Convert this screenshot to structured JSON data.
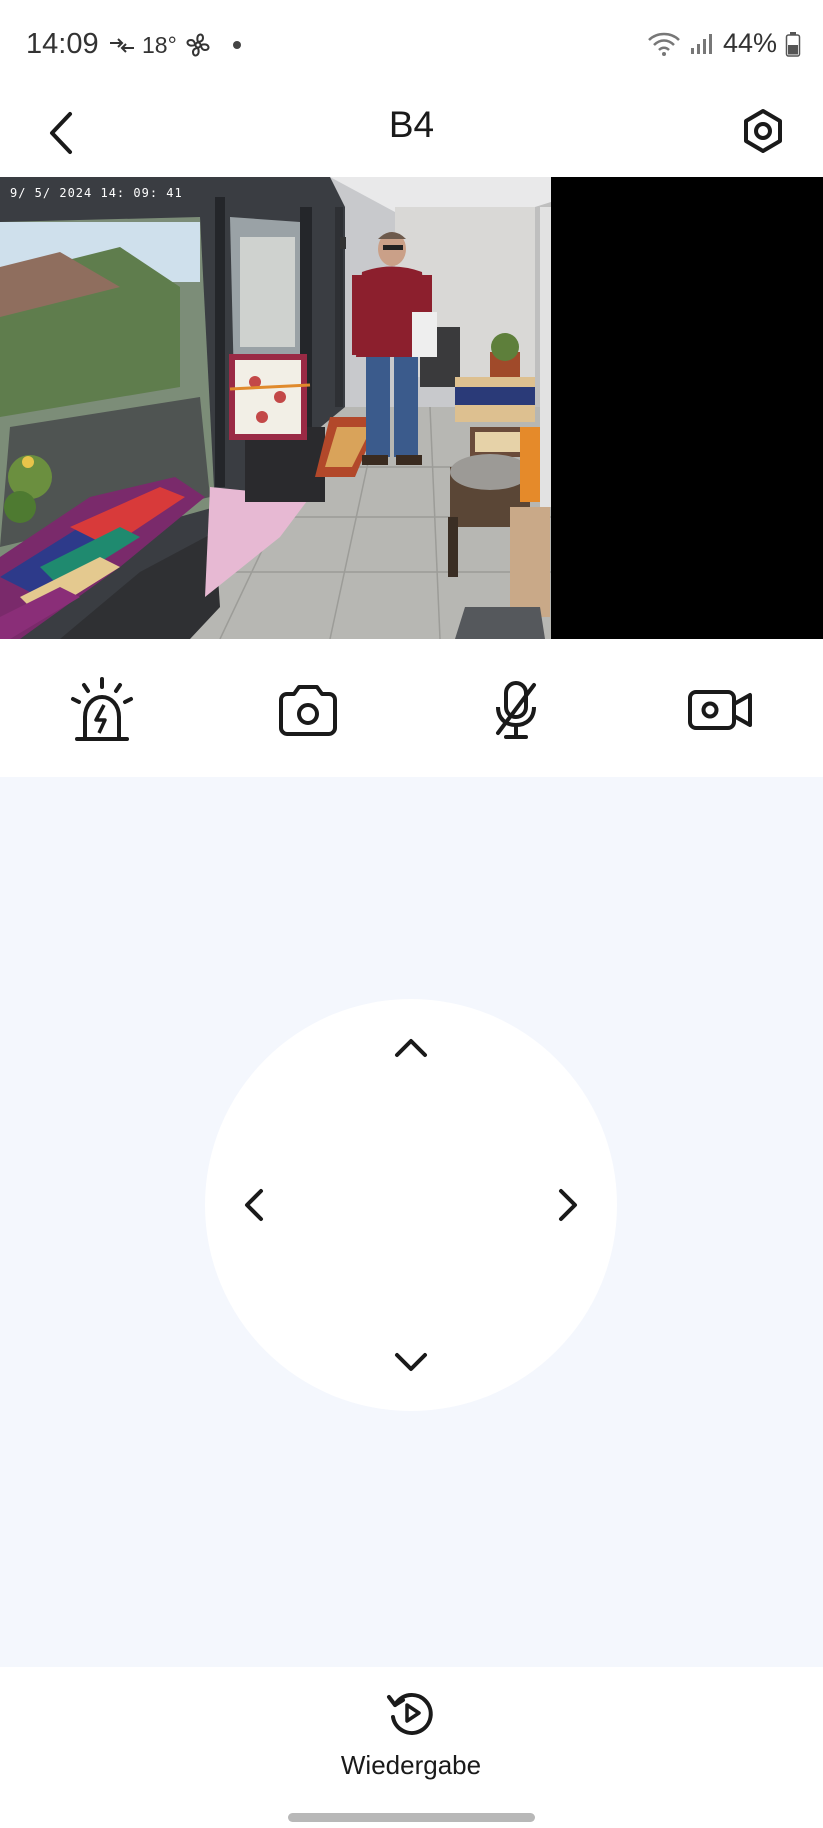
{
  "status_bar": {
    "time": "14:09",
    "temperature": "18°",
    "battery": "44%",
    "icons": [
      "data-transfer-icon",
      "fan-icon",
      "notification-dot",
      "wifi-icon",
      "signal-icon",
      "battery-icon"
    ]
  },
  "header": {
    "title": "B4",
    "back_icon": "chevron-left-icon",
    "settings_icon": "hexagon-settings-icon"
  },
  "video": {
    "timestamp": "9/ 5/ 2024  14: 09: 41"
  },
  "controls": [
    {
      "name": "siren-button",
      "icon": "siren-icon"
    },
    {
      "name": "snapshot-button",
      "icon": "camera-icon"
    },
    {
      "name": "microphone-button",
      "icon": "microphone-muted-icon"
    },
    {
      "name": "record-button",
      "icon": "video-camera-icon"
    }
  ],
  "ptz": {
    "up_icon": "chevron-up-icon",
    "down_icon": "chevron-down-icon",
    "left_icon": "chevron-left-icon",
    "right_icon": "chevron-right-icon"
  },
  "bottom": {
    "playback_label": "Wiedergabe",
    "playback_icon": "replay-icon"
  },
  "colors": {
    "ptz_background": "#f4f7fd",
    "icon": "#1a1a1a",
    "video_letterbox": "#000000"
  }
}
